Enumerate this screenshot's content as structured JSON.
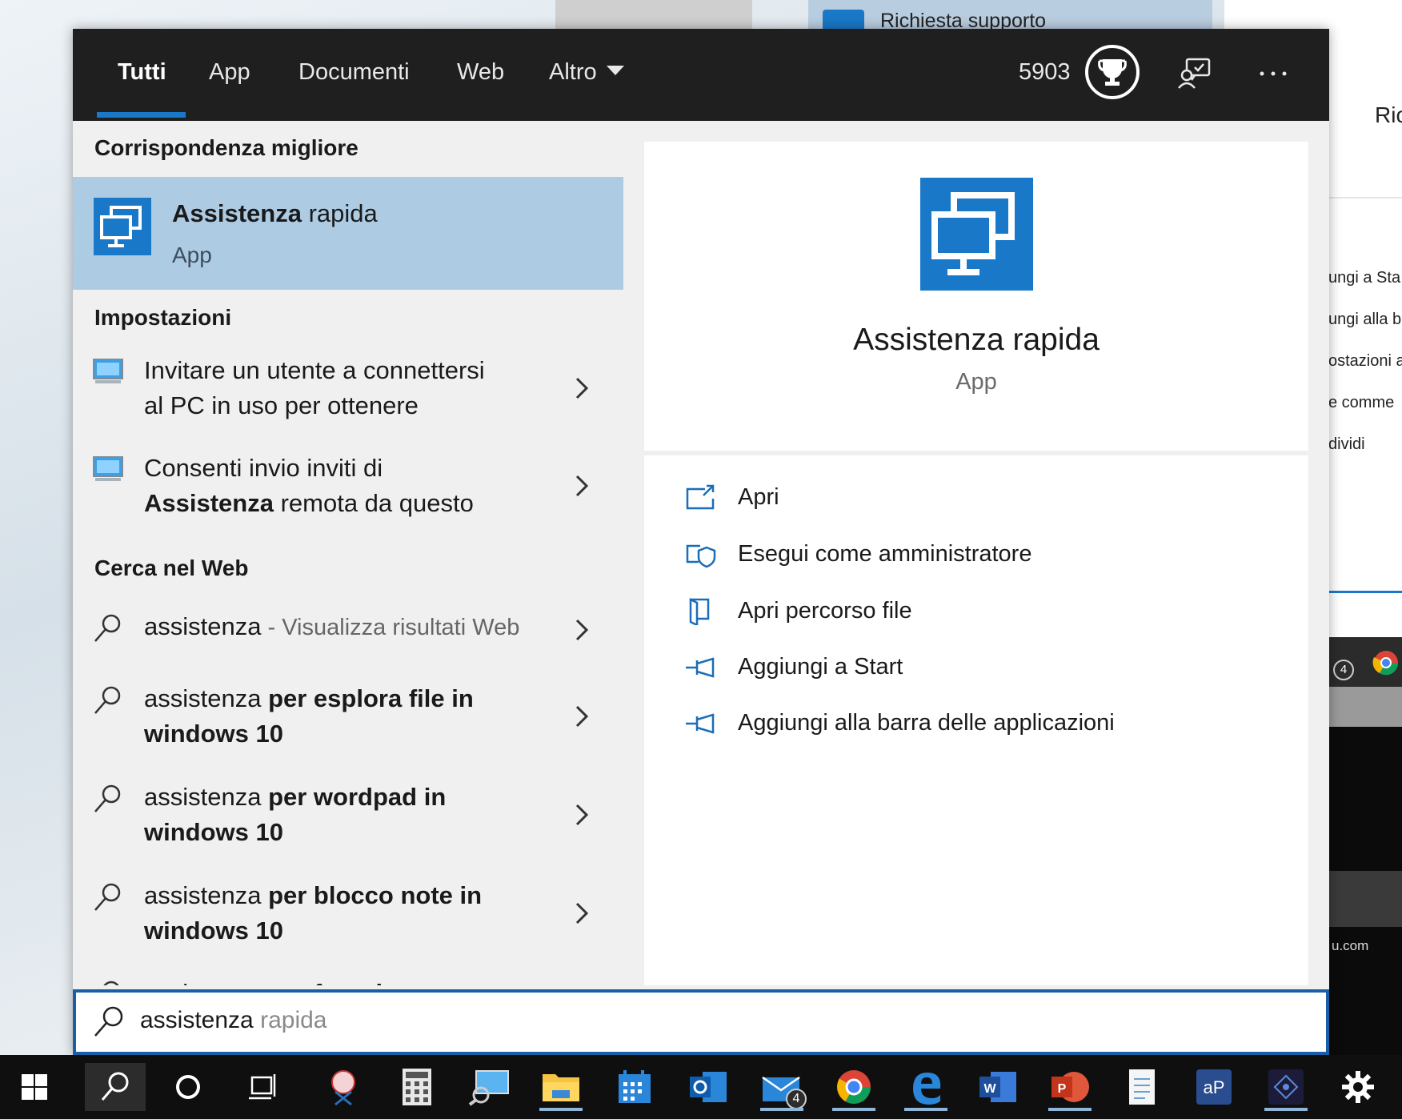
{
  "background": {
    "window_title": "Richiesta supporto",
    "right_heading": "Ric",
    "right_menu": [
      "ungi a Sta",
      "ungi alla b",
      "ostazioni a",
      "e comme",
      "dividi"
    ],
    "right_email": "u.com"
  },
  "tabs": [
    {
      "label": "Tutti",
      "active": true
    },
    {
      "label": "App"
    },
    {
      "label": "Documenti"
    },
    {
      "label": "Web"
    },
    {
      "label": "Altro"
    }
  ],
  "header": {
    "points": "5903",
    "trophy_icon": "trophy-icon",
    "feedback_icon": "feedback-icon",
    "more_icon": "more-icon"
  },
  "left": {
    "best_match_title": "Corrispondenza migliore",
    "best_match": {
      "name_bold": "Assistenza",
      "name_rest": " rapida",
      "type": "App"
    },
    "settings_title": "Impostazioni",
    "settings": [
      {
        "line1": "Invitare un utente a connettersi",
        "line2": "al PC in uso per ottenere"
      },
      {
        "line1": "Consenti invio inviti di",
        "line2_bold": "Assistenza",
        "line2_rest": " remota da questo"
      }
    ],
    "web_title": "Cerca nel Web",
    "web": [
      {
        "query": "assistenza",
        "suffix": " - Visualizza risultati Web"
      },
      {
        "query": "assistenza",
        "bold": " per esplora file in",
        "line2": "windows 10"
      },
      {
        "query": "assistenza",
        "bold": " per wordpad in",
        "line2": "windows 10"
      },
      {
        "query": "assistenza",
        "bold": " per blocco note in",
        "line2": "windows 10"
      },
      {
        "query": "assistenza",
        "bold": " per foto d..."
      }
    ]
  },
  "preview": {
    "name": "Assistenza rapida",
    "type": "App",
    "actions": [
      {
        "label": "Apri",
        "icon": "open-icon"
      },
      {
        "label": "Esegui come amministratore",
        "icon": "shield-icon"
      },
      {
        "label": "Apri percorso file",
        "icon": "file-location-icon"
      },
      {
        "label": "Aggiungi a Start",
        "icon": "pin-icon"
      },
      {
        "label": "Aggiungi alla barra delle applicazioni",
        "icon": "pin-icon"
      }
    ]
  },
  "search": {
    "typed": "assistenza",
    "completion": " rapida"
  },
  "taskbar": {
    "mail_badge": "4",
    "bg_badge": "4"
  },
  "colors": {
    "accent": "#1a78c8",
    "selected_row": "#aecbe4",
    "topbar": "#1f1f1f"
  }
}
